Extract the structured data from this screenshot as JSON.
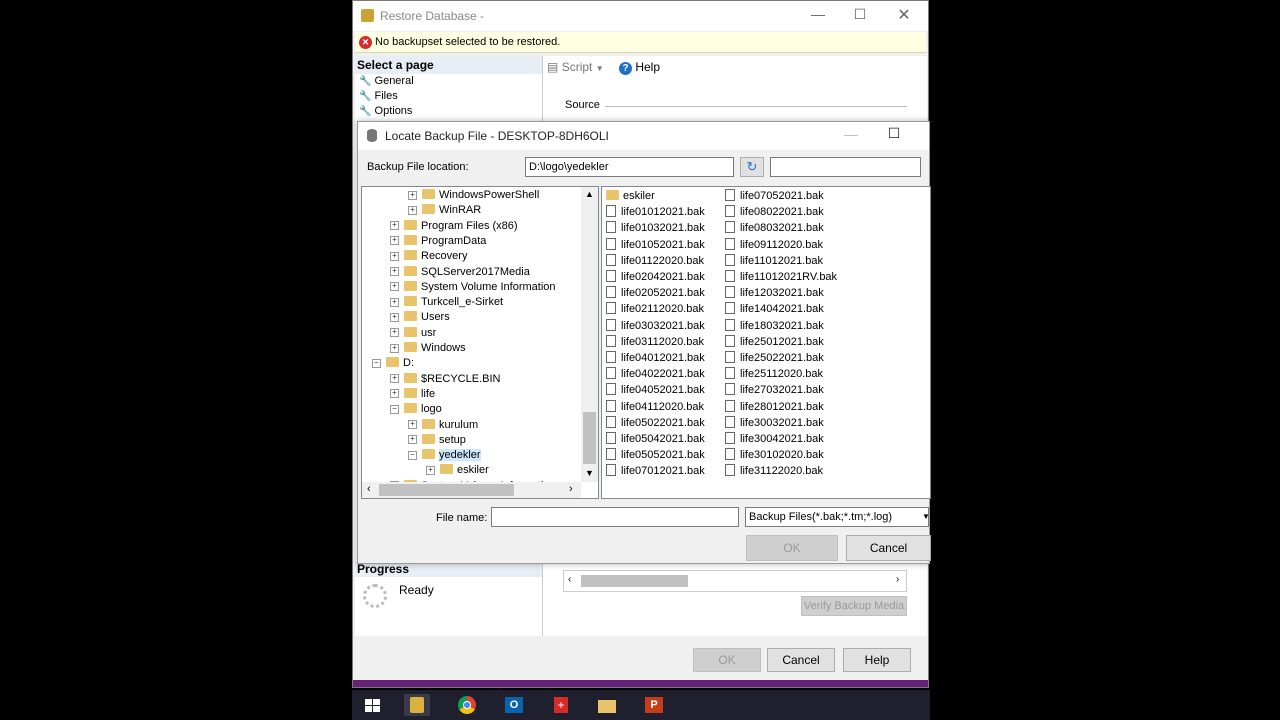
{
  "restore": {
    "title": "Restore Database -",
    "error": "No backupset selected to be restored.",
    "select_page": "Select a page",
    "pages": [
      "General",
      "Files",
      "Options"
    ],
    "script_label": "Script",
    "help_label": "Help",
    "source_label": "Source",
    "progress_label": "Progress",
    "ready_label": "Ready",
    "verify_label": "Verify Backup Media",
    "ok_label": "OK",
    "cancel_label": "Cancel",
    "help_button_label": "Help",
    "status_partial": "Ready"
  },
  "locate": {
    "title": "Locate Backup File - DESKTOP-8DH6OLI",
    "location_label": "Backup File location:",
    "location_value": "D:\\logo\\yedekler",
    "tree": [
      {
        "label": "WindowsPowerShell",
        "level": 2,
        "exp": "+"
      },
      {
        "label": "WinRAR",
        "level": 2,
        "exp": "+"
      },
      {
        "label": "Program Files (x86)",
        "level": 1,
        "exp": "+"
      },
      {
        "label": "ProgramData",
        "level": 1,
        "exp": "+"
      },
      {
        "label": "Recovery",
        "level": 1,
        "exp": "+"
      },
      {
        "label": "SQLServer2017Media",
        "level": 1,
        "exp": "+"
      },
      {
        "label": "System Volume Information",
        "level": 1,
        "exp": "+"
      },
      {
        "label": "Turkcell_e-Sirket",
        "level": 1,
        "exp": "+"
      },
      {
        "label": "Users",
        "level": 1,
        "exp": "+"
      },
      {
        "label": "usr",
        "level": 1,
        "exp": "+"
      },
      {
        "label": "Windows",
        "level": 1,
        "exp": "+"
      },
      {
        "label": "D:",
        "level": 0,
        "exp": "-"
      },
      {
        "label": "$RECYCLE.BIN",
        "level": 1,
        "exp": "+"
      },
      {
        "label": "life",
        "level": 1,
        "exp": "+"
      },
      {
        "label": "logo",
        "level": 1,
        "exp": "-"
      },
      {
        "label": "kurulum",
        "level": 2,
        "exp": "+"
      },
      {
        "label": "setup",
        "level": 2,
        "exp": "+"
      },
      {
        "label": "yedekler",
        "level": 2,
        "exp": "-",
        "selected": true
      },
      {
        "label": "eskiler",
        "level": 3,
        "exp": "+"
      },
      {
        "label": "System Volume Information",
        "level": 1,
        "exp": "+"
      }
    ],
    "files_col1": [
      "eskiler",
      "life01012021.bak",
      "life01032021.bak",
      "life01052021.bak",
      "life01122020.bak",
      "life02042021.bak",
      "life02052021.bak",
      "life02112020.bak",
      "life03032021.bak",
      "life03112020.bak",
      "life04012021.bak",
      "life04022021.bak",
      "life04052021.bak",
      "life04112020.bak",
      "life05022021.bak",
      "life05042021.bak",
      "life05052021.bak",
      "life07012021.bak"
    ],
    "files_col2": [
      "life07052021.bak",
      "life08022021.bak",
      "life08032021.bak",
      "life09112020.bak",
      "life11012021.bak",
      "life11012021RV.bak",
      "life12032021.bak",
      "life14042021.bak",
      "life18032021.bak",
      "life25012021.bak",
      "life25022021.bak",
      "life25112020.bak",
      "life27032021.bak",
      "life28012021.bak",
      "life30032021.bak",
      "life30042021.bak",
      "life30102020.bak",
      "life31122020.bak"
    ],
    "filename_label": "File name:",
    "filename_value": "",
    "filter_value": "Backup Files(*.bak;*.tm;*.log)",
    "ok_label": "OK",
    "cancel_label": "Cancel"
  },
  "colors": {
    "folder": "#e8c46a",
    "error": "#d62b2b",
    "selection": "#cce8ff",
    "accent": "#0078d7"
  }
}
